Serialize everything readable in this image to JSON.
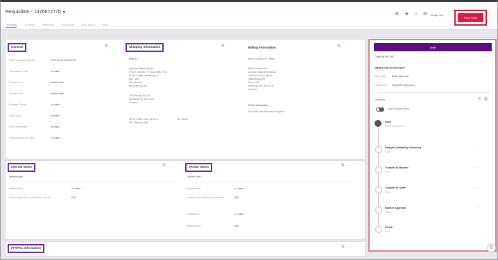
{
  "header": {
    "title": "Requisition - 1476672770",
    "tabs": [
      "Summary",
      "Line Items",
      "Preferences",
      "Documents",
      "Order History",
      "Notes"
    ],
    "assign_cart": "Assign Cart",
    "place_order": "Place Order"
  },
  "general": {
    "title": "General",
    "rows": [
      {
        "k": "Date Requested (Barre)",
        "v": "2021-06-18 6:00:00 CE"
      },
      {
        "k": "Transaction Code",
        "v": "no value"
      },
      {
        "k": "Prepared For",
        "v": "Nadia Smith"
      },
      {
        "k": "Prepared By",
        "v": "Nadia Smith"
      },
      {
        "k": "Prepared Tenure",
        "v": "no value"
      },
      {
        "k": "Cost Code",
        "v": "no value"
      },
      {
        "k": "Price Information",
        "v": "no value"
      },
      {
        "k": "Good Receipt Line Item",
        "v": "no value"
      }
    ]
  },
  "shipping": {
    "title": "Shipping Information",
    "ship_to": "Ship to",
    "address": [
      "Attention: Nadia Smith",
      "Phone Number: +1 (514) 555-7712",
      "Email: nadia.smith@org.ca",
      "Bus. Unit",
      "Bus Number",
      "Bill-Order-ca.org"
    ],
    "address2": [
      "1663 Bundy Rd, 20",
      "Montreal, QC H3Z 2Y8",
      "Canada"
    ],
    "extra_left": [
      "Bill To Code: 2013 04 02 3...",
      "Est. Delivery Date"
    ],
    "extra_right": "No. 02302"
  },
  "billing": {
    "title": "Billing Information",
    "bill_to": "Bill to Catalyst Inc. billed",
    "address": [
      "Bill-to Carrera Inc.",
      "carrera.enquiries@org.ca",
      "Unit Accounts Payable",
      "1663 Bundy Rd",
      "Room 230",
      "Montreal, QC H3Z 2Y8",
      "Canada"
    ],
    "pcard_title": "PCard Information",
    "pcard_text": "No credit card has been assigned."
  },
  "internal_notes": {
    "title": "Internal Notes",
    "subhead": "Internal Note",
    "rows": [
      {
        "k": "Internal Note",
        "v": "no value"
      },
      {
        "k": "Internal Note will not be sent to vendor",
        "v": "Edit"
      }
    ]
  },
  "vendor_notes": {
    "title": "Vendor Notes",
    "subhead": "Vendor Note",
    "rows": [
      {
        "k": "Vendor Note",
        "v": "no value"
      },
      {
        "k": "Vendor Note will be sent to vendor",
        "v": "Edit"
      },
      {
        "k": "Comments",
        "v": "no value"
      },
      {
        "k": "Attachments",
        "v": "Edit"
      }
    ]
  },
  "fiscal": {
    "title": "FFAPAL Information"
  },
  "workflow": {
    "status": "Draft",
    "total_label": "Total: $9.99 CAD",
    "next_label": "What's next for my order?",
    "next_rows": [
      {
        "k": "Next Step",
        "v": "Buyer Approval"
      },
      {
        "k": "Approvers",
        "v": "Requester Approvers"
      }
    ],
    "heading": "Workflow",
    "toggle_label": "Show skipped steps",
    "steps": [
      {
        "name": "Draft",
        "sub": "Active · Nadia Smith"
      },
      {
        "name": "Budget Availability Checking",
        "sub": "Future"
      },
      {
        "name": "Transfer to Banner",
        "sub": "Future"
      },
      {
        "name": "Transfer to SIMP",
        "sub": "Future"
      },
      {
        "name": "Banner Approval",
        "sub": "Future"
      },
      {
        "name": "Finish",
        "sub": "Future"
      }
    ]
  }
}
